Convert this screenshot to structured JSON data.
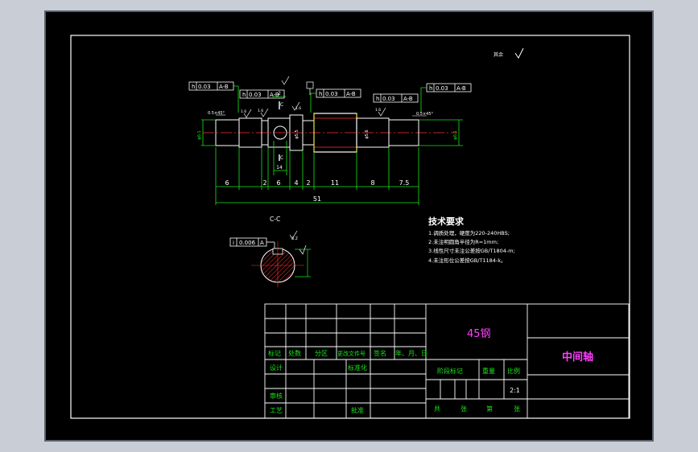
{
  "drawing": {
    "scale_note": "其余 ",
    "title_part": "中间轴",
    "material": "45钢",
    "colors": {
      "background": "#000000",
      "line": "#ffffff",
      "green": "#19e619",
      "cyan": "#22e0e0",
      "red": "#ff3030",
      "yellow": "#e6e619",
      "magenta": "#ff40ff",
      "frame_bg": "#c9ced6"
    }
  },
  "tolerances": [
    {
      "sym": "h",
      "value": "0.03",
      "datum": "A-B"
    },
    {
      "sym": "h",
      "value": "0.03",
      "datum": "A-B"
    },
    {
      "sym": "h",
      "value": "0.03",
      "datum": "A-B"
    },
    {
      "sym": "h",
      "value": "0.03",
      "datum": "A-B"
    },
    {
      "sym": "i",
      "value": "0.006",
      "datum": "A"
    }
  ],
  "chamfers": [
    "0.5×45°",
    "0.5×45°"
  ],
  "roughness": [
    "1.6",
    "1.6",
    "1.6",
    "1.6",
    "3.2"
  ],
  "dims_bottom": [
    "6",
    "2",
    "6",
    "4",
    "2",
    "11",
    "8",
    "7.5"
  ],
  "dim_total": "51",
  "small_labels": {
    "c1": "C",
    "c2": "C",
    "n14": "14",
    "dia_left": "φ5.5",
    "dia_mid": "φ5.6",
    "dia_a": "φ0.1",
    "dia_b": "φ0.1",
    "t2": "2"
  },
  "section": {
    "title": "C-C"
  },
  "tech": {
    "title": "技术要求",
    "items": [
      "1.调质处理，硬度为220-240HBS;",
      "2.未注明圆角半径为R=1mm;",
      "3.线性尺寸未注公差按GB/T1804-m;",
      "4.未注形位公差按GB/T1184-k。"
    ]
  },
  "title_block": {
    "row_labels": [
      "标记",
      "处数",
      "分区",
      "更改文件号",
      "签名",
      "年、月、日"
    ],
    "design": "设计",
    "standard": "标准化",
    "review": "审核",
    "process": "工艺",
    "approve": "批准",
    "stage": "阶段标记",
    "weight": "重量",
    "scale": "比例",
    "scale_value": "2:1",
    "sheets": [
      "共",
      "张",
      "第",
      "张"
    ]
  }
}
